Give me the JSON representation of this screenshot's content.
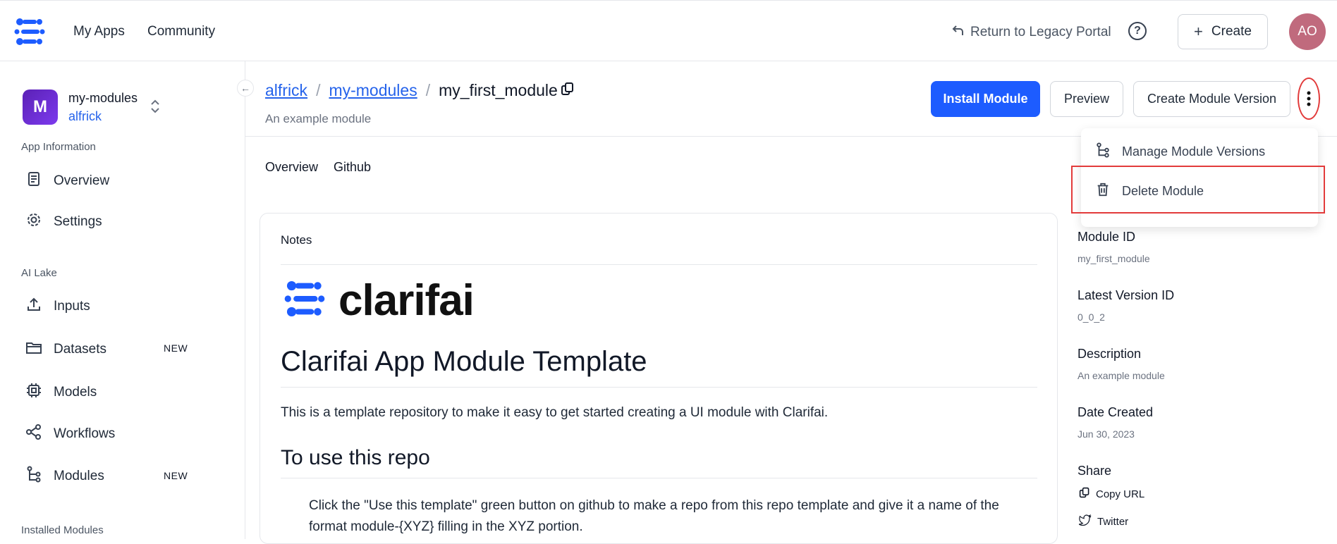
{
  "topbar": {
    "nav": [
      "My Apps",
      "Community"
    ],
    "legacy_link": "Return to Legacy Portal",
    "help_label": "?",
    "create_label": "Create",
    "avatar_initials": "AO"
  },
  "sidebar": {
    "app_initial": "M",
    "app_name": "my-modules",
    "app_owner": "alfrick",
    "sections": {
      "app_information": "App Information",
      "ai_lake": "AI Lake",
      "installed_modules": "Installed Modules"
    },
    "items": {
      "overview": "Overview",
      "settings": "Settings",
      "inputs": "Inputs",
      "datasets": "Datasets",
      "models": "Models",
      "workflows": "Workflows",
      "modules": "Modules"
    },
    "new_badge": "NEW"
  },
  "header": {
    "crumb_owner": "alfrick",
    "crumb_app": "my-modules",
    "crumb_module": "my_first_module",
    "subtitle": "An example module",
    "install_label": "Install Module",
    "preview_label": "Preview",
    "create_version_label": "Create Module Version"
  },
  "tabs": [
    "Overview",
    "Github"
  ],
  "notes": {
    "title": "Notes",
    "brand": "clarifai",
    "h1": "Clarifai App Module Template",
    "p1": "This is a template repository to make it easy to get started creating a UI module with Clarifai.",
    "h2": "To use this repo",
    "p2": "Click the \"Use this template\" green button on github to make a repo from this repo template and give it a name of the format module-{XYZ} filling in the XYZ portion."
  },
  "details": {
    "module_id_label": "Module ID",
    "module_id": "my_first_module",
    "version_label": "Latest Version ID",
    "version": "0_0_2",
    "description_label": "Description",
    "description": "An example module",
    "date_label": "Date Created",
    "date": "Jun 30, 2023",
    "share_label": "Share",
    "copy_url": "Copy URL",
    "twitter": "Twitter"
  },
  "menu": {
    "manage_versions": "Manage Module Versions",
    "delete_module": "Delete Module"
  },
  "colors": {
    "primary": "#1d5cff",
    "link": "#2563eb",
    "highlight": "#e23b3b",
    "avatar": "#c06a7d"
  }
}
